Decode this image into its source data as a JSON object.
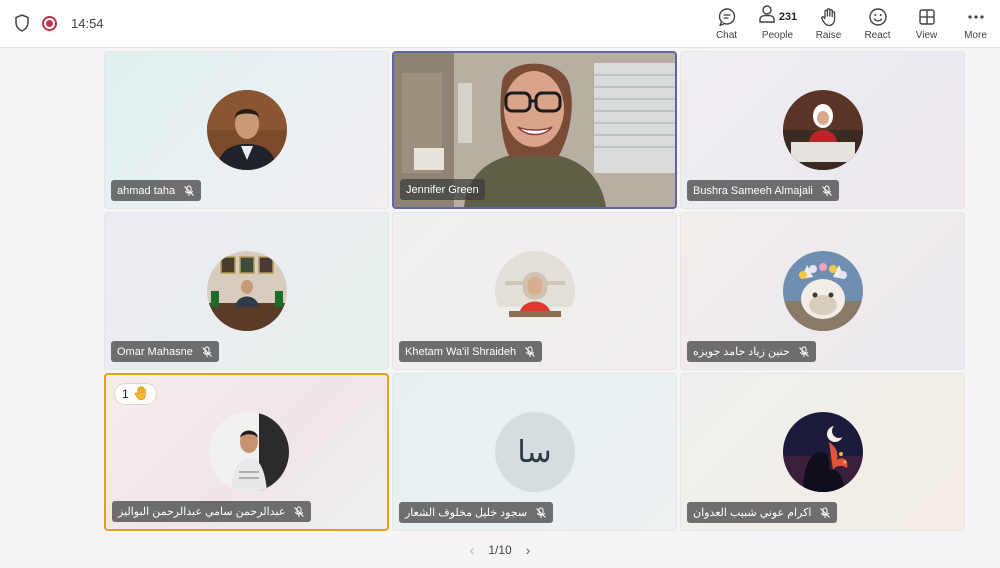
{
  "header": {
    "time": "14:54",
    "people_count": "231",
    "buttons": {
      "chat": "Chat",
      "people": "People",
      "raise": "Raise",
      "react": "React",
      "view": "View",
      "more": "More"
    }
  },
  "participants": [
    {
      "name": "ahmad taha",
      "muted": true
    },
    {
      "name": "Jennifer Green",
      "muted": false,
      "video": true
    },
    {
      "name": "Bushra Sameeh Almajali",
      "muted": true
    },
    {
      "name": "Omar Mahasne",
      "muted": true
    },
    {
      "name": "Khetam Wa'il Shraideh",
      "muted": true
    },
    {
      "name": "حنين زياد حامد جويزه",
      "muted": true
    },
    {
      "name": "عبدالرحمن سامي عبدالرحمن البواليز",
      "muted": true,
      "hand_count": "1"
    },
    {
      "name": "سجود خليل مخلوف الشعار",
      "muted": true,
      "initials": "سا"
    },
    {
      "name": "اكرام عوني شبيب العدوان",
      "muted": true
    }
  ],
  "pager": {
    "label": "1/10"
  },
  "colors": {
    "accent": "#6264a7",
    "raise": "#e3a21a",
    "record": "#c4314b"
  }
}
